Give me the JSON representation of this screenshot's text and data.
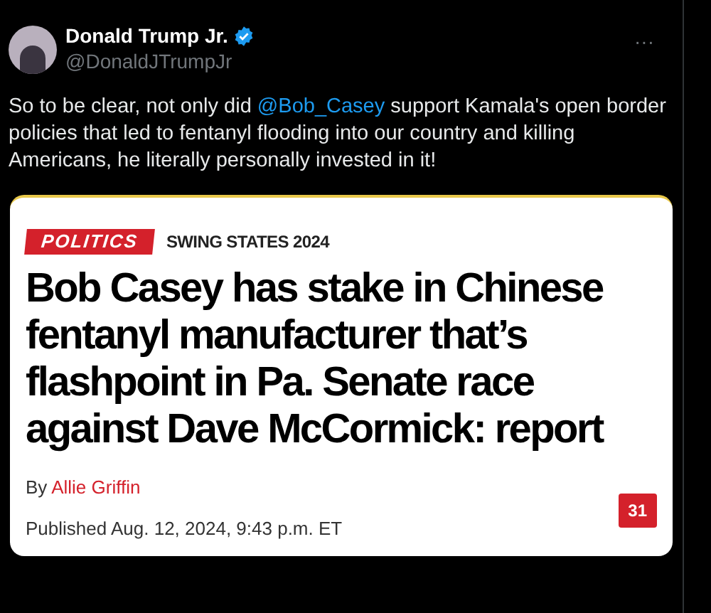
{
  "post": {
    "author": "Donald Trump Jr.",
    "verified": true,
    "handle": "@DonaldJTrumpJr",
    "more": "···",
    "text": [
      {
        "kind": "text",
        "value": "So to be clear, not only did "
      },
      {
        "kind": "mention",
        "value": "@Bob_Casey"
      },
      {
        "kind": "text",
        "value": " support Kamala's open border policies that led to fentanyl flooding into our country and killing Americans, he literally personally invested in it!"
      }
    ],
    "article": {
      "category": "POLITICS",
      "section": "SWING STATES 2024",
      "headline": "Bob Casey has stake in Chinese fentanyl manufacturer that’s flashpoint in Pa. Senate race against Dave McCormick: report",
      "byline_prefix": "By",
      "byline_author": "Allie Griffin",
      "published": "Published Aug. 12, 2024, 9:43 p.m. ET",
      "comment_count": "31"
    }
  }
}
